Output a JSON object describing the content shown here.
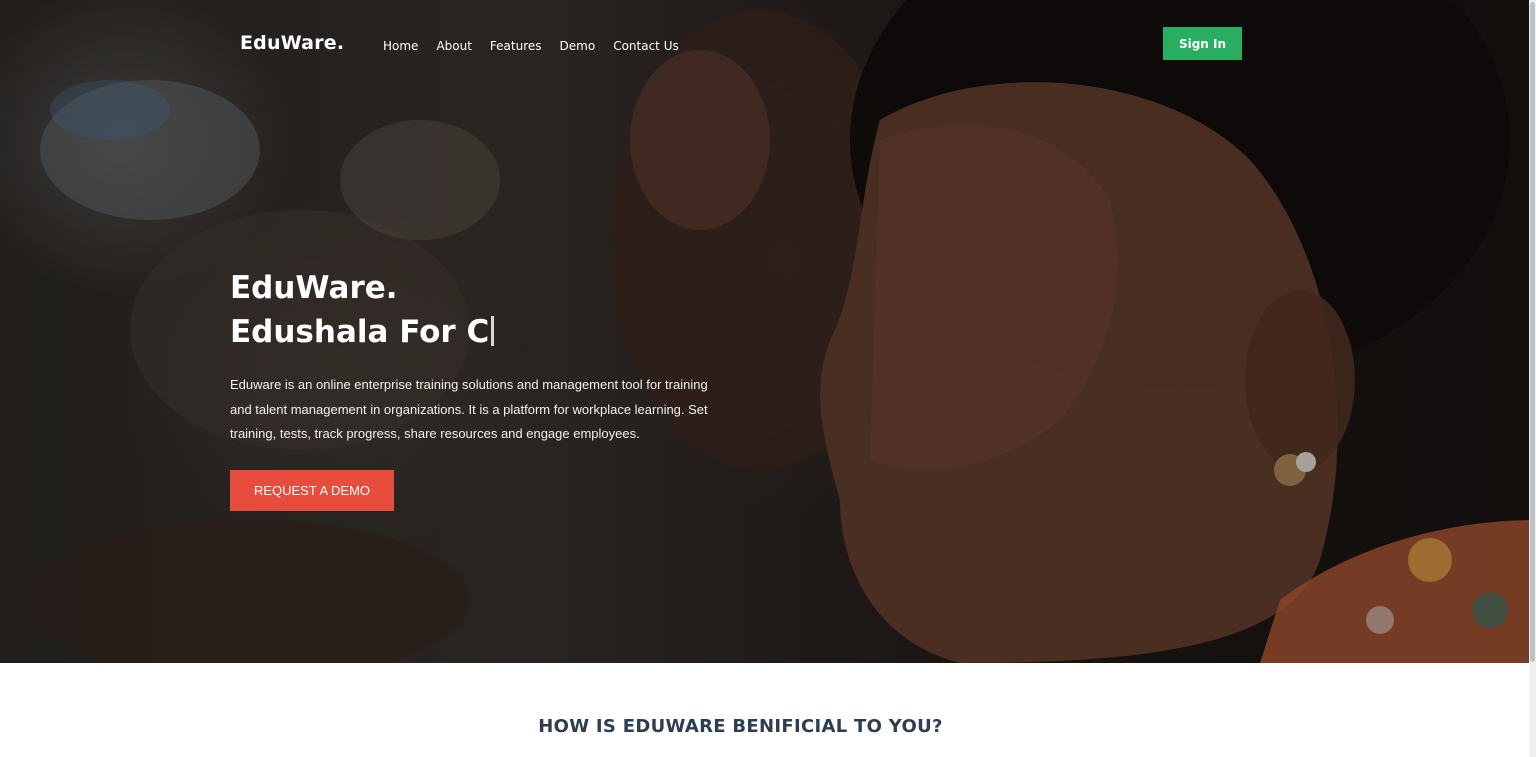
{
  "nav": {
    "brand": "EduWare.",
    "links": [
      "Home",
      "About",
      "Features",
      "Demo",
      "Contact Us"
    ],
    "signin_label": "Sign In"
  },
  "hero": {
    "title_line1": "EduWare.",
    "title_line2": "Edushala For C",
    "description": "Eduware is an online enterprise training solutions and management tool for training and talent management in organizations. It is a platform for workplace learning. Set training, tests, track progress, share resources and engage employees.",
    "cta_label": "REQUEST A DEMO"
  },
  "section": {
    "heading": "HOW IS EDUWARE BENIFICIAL TO YOU?"
  },
  "colors": {
    "signin": "#27ae60",
    "cta": "#e74c3c",
    "heading_text": "#2c3e50"
  }
}
